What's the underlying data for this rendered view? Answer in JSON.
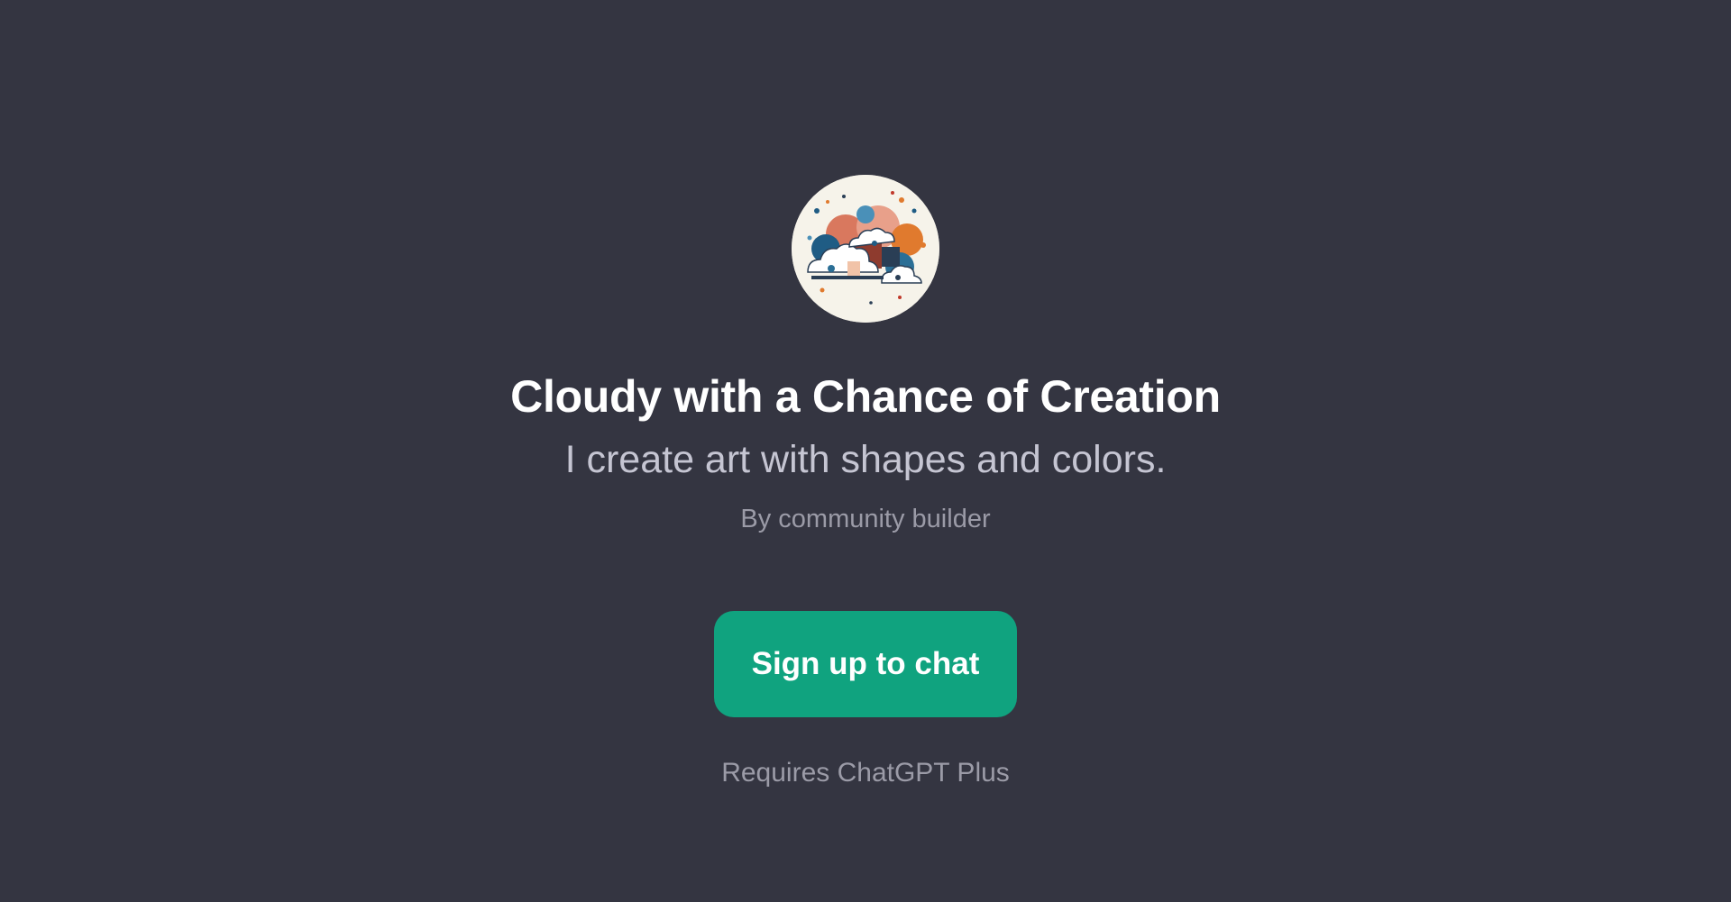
{
  "gpt": {
    "avatar_icon": "cloud-art-avatar",
    "name": "Cloudy with a Chance of Creation",
    "description": "I create art with shapes and colors.",
    "author": "By community builder"
  },
  "cta": {
    "label": "Sign up to chat",
    "color": "#10a37f"
  },
  "footer": {
    "note": "Requires ChatGPT Plus"
  },
  "theme": {
    "background": "#343541",
    "title_color": "#ffffff",
    "subtitle_color": "#c5c5d2",
    "muted_color": "#9b9ba7"
  }
}
